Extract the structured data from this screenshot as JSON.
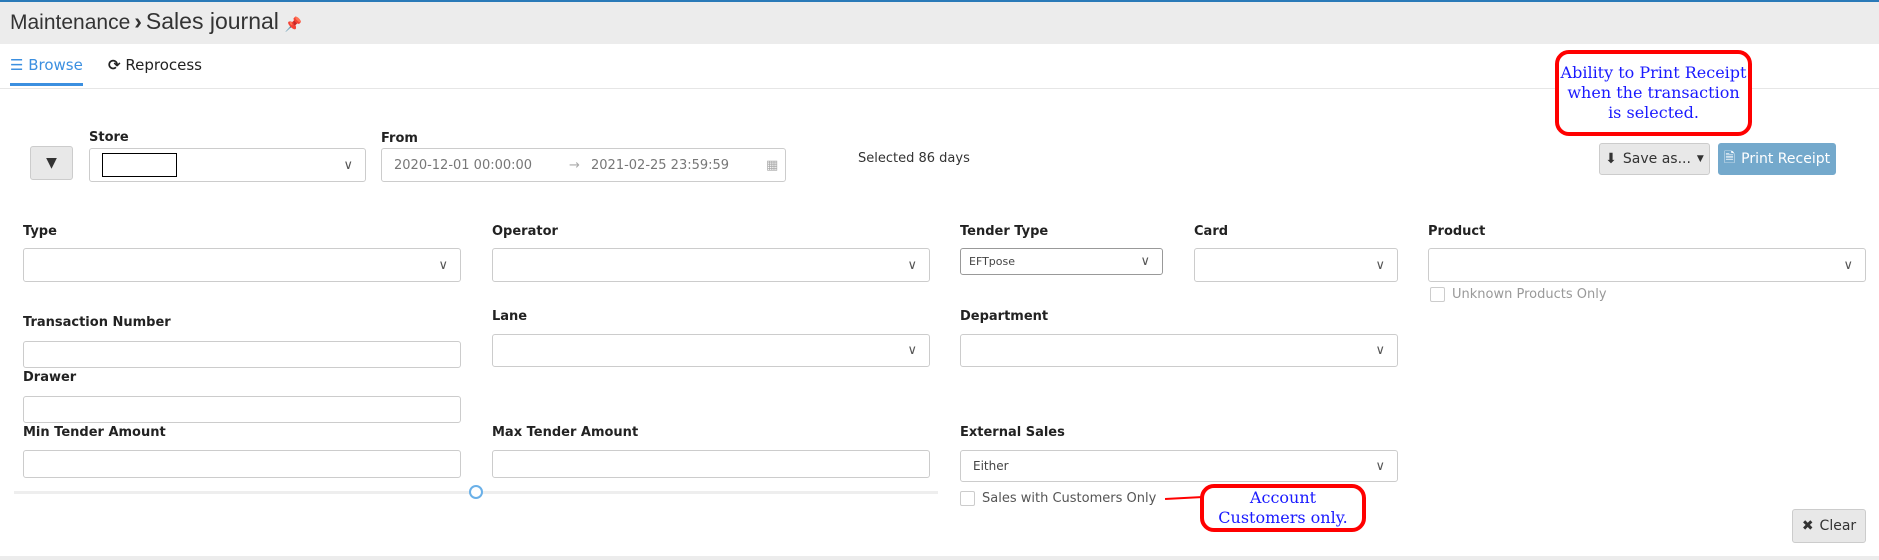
{
  "header": {
    "breadcrumb_parent": "Maintenance",
    "separator": "›",
    "title": "Sales journal",
    "pin_icon": "pin-icon"
  },
  "tabs": [
    {
      "label": "Browse",
      "icon": "list-icon",
      "active": true
    },
    {
      "label": "Reprocess",
      "icon": "refresh-icon",
      "active": false
    }
  ],
  "filters": {
    "store": {
      "label": "Store",
      "value": ""
    },
    "from": {
      "label": "From",
      "start": "2020-12-01 00:00:00",
      "end": "2021-02-25 23:59:59",
      "arrow": "→"
    },
    "selected_days": "Selected 86 days",
    "type": {
      "label": "Type",
      "value": ""
    },
    "operator": {
      "label": "Operator",
      "value": ""
    },
    "tender_type": {
      "label": "Tender Type",
      "value": "EFTpose"
    },
    "card": {
      "label": "Card",
      "value": ""
    },
    "product": {
      "label": "Product",
      "value": ""
    },
    "unknown_products": {
      "label": "Unknown Products Only",
      "checked": false
    },
    "transaction_number": {
      "label": "Transaction Number",
      "value": ""
    },
    "lane": {
      "label": "Lane",
      "value": ""
    },
    "department": {
      "label": "Department",
      "value": ""
    },
    "drawer": {
      "label": "Drawer",
      "value": ""
    },
    "min_tender": {
      "label": "Min Tender Amount",
      "value": ""
    },
    "max_tender": {
      "label": "Max Tender Amount",
      "value": ""
    },
    "external_sales": {
      "label": "External Sales",
      "value": "Either"
    },
    "customers_only": {
      "label": "Sales with Customers Only",
      "checked": false
    }
  },
  "actions": {
    "save_as": "Save as...",
    "print_receipt": "Print Receipt",
    "clear": "Clear"
  },
  "annotations": {
    "print": "Ability to Print Receipt when the transaction is selected.",
    "customers": "Account Customers only."
  },
  "colors": {
    "accent": "#3b8fe0",
    "print_button": "#74a9cc",
    "callout_border": "#ff0000",
    "callout_text": "#1a1aff"
  }
}
